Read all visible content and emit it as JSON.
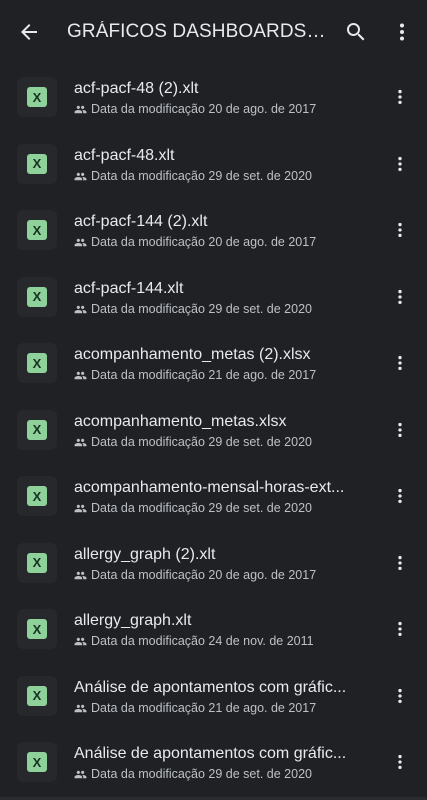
{
  "header": {
    "title": "GRÁFICOS DASHBOARDS D...",
    "back_icon": "arrow-back-icon",
    "search_icon": "search-icon",
    "more_icon": "more-vert-icon"
  },
  "files": [
    {
      "name": "acf-pacf-48 (2).xlt",
      "meta": "Data da modificação 20 de ago. de 2017"
    },
    {
      "name": "acf-pacf-48.xlt",
      "meta": "Data da modificação 29 de set. de 2020"
    },
    {
      "name": "acf-pacf-144 (2).xlt",
      "meta": "Data da modificação 20 de ago. de 2017"
    },
    {
      "name": "acf-pacf-144.xlt",
      "meta": "Data da modificação 29 de set. de 2020"
    },
    {
      "name": "acompanhamento_metas (2).xlsx",
      "meta": "Data da modificação 21 de ago. de 2017"
    },
    {
      "name": "acompanhamento_metas.xlsx",
      "meta": "Data da modificação 29 de set. de 2020"
    },
    {
      "name": "acompanhamento-mensal-horas-ext...",
      "meta": "Data da modificação 29 de set. de 2020"
    },
    {
      "name": "allergy_graph (2).xlt",
      "meta": "Data da modificação 20 de ago. de 2017"
    },
    {
      "name": "allergy_graph.xlt",
      "meta": "Data da modificação 24 de nov. de 2011"
    },
    {
      "name": "Análise de apontamentos com gráfic...",
      "meta": "Data da modificação 21 de ago. de 2017"
    },
    {
      "name": "Análise de apontamentos com gráfic...",
      "meta": "Data da modificação 29 de set. de 2020"
    }
  ],
  "file_type_badge": "X",
  "colors": {
    "background": "#1f2124",
    "badge": "#8fd19b",
    "text": "#e8eaed",
    "meta_text": "#bdc1c6"
  }
}
